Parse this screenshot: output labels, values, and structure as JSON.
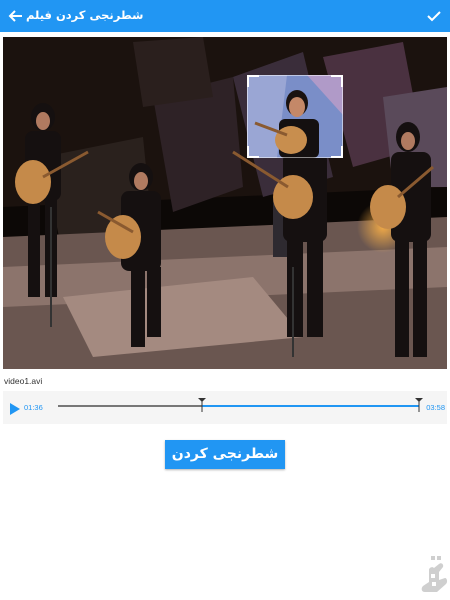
{
  "header": {
    "title": "شطرنجی کردن فیلم",
    "back_icon": "arrow-left-icon",
    "done_icon": "check-icon",
    "bg_color": "#2196f3"
  },
  "video": {
    "filename": "video1.avi"
  },
  "player": {
    "time_start": "01:36",
    "time_end": "03:58",
    "start_position": 0.4,
    "end_position": 1.0,
    "play_icon": "play-icon"
  },
  "action": {
    "label": "شطرنجی کردن"
  },
  "brand": {
    "icon": "logo-icon"
  }
}
